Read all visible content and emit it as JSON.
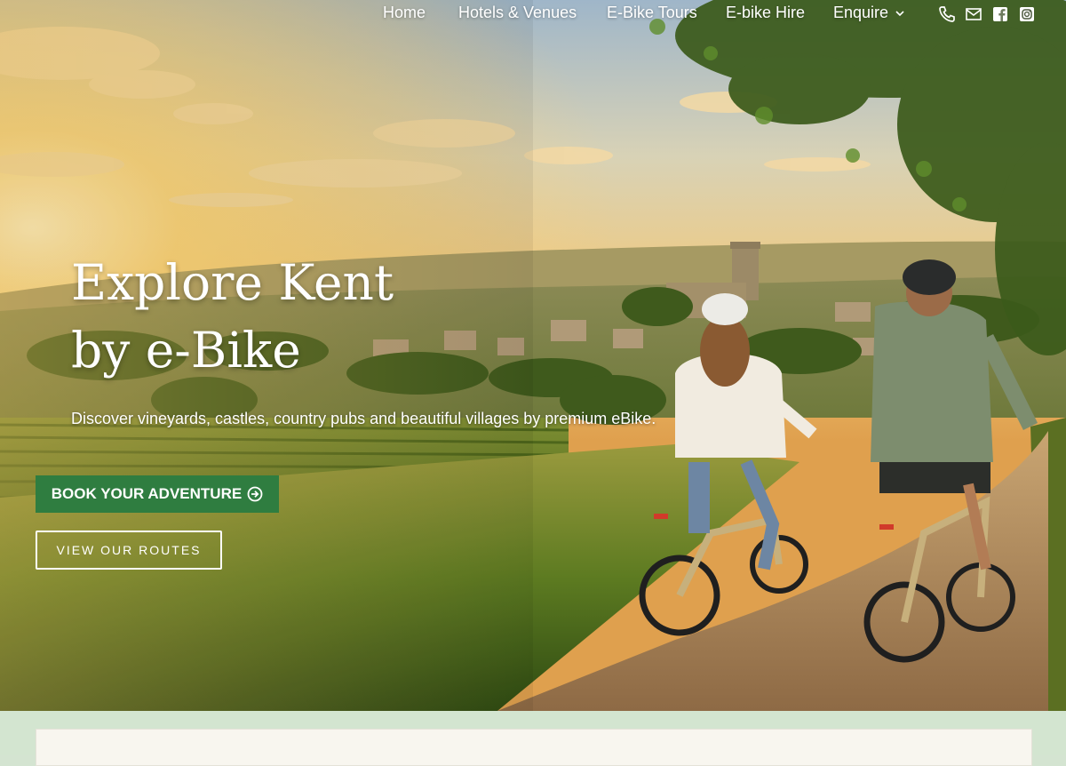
{
  "nav": {
    "items": [
      {
        "label": "Home"
      },
      {
        "label": "Hotels & Venues"
      },
      {
        "label": "E-Bike Tours"
      },
      {
        "label": "E-bike Hire"
      },
      {
        "label": "Enquire"
      }
    ],
    "icons": [
      "phone-icon",
      "email-icon",
      "facebook-icon",
      "instagram-icon"
    ]
  },
  "hero": {
    "title_line1": "Explore Kent",
    "title_line2": "by e-Bike",
    "subtitle": "Discover vineyards, castles, country pubs and beautiful villages by premium eBike.",
    "primary_button": "BOOK YOUR ADVENTURE",
    "secondary_button": "VIEW OUR ROUTES",
    "image_description": ""
  },
  "colors": {
    "primary_button_bg": "#2f7d40",
    "lower_band_bg": "#d3e5d0",
    "card_bg": "#f8f6ef",
    "text": "#ffffff"
  }
}
